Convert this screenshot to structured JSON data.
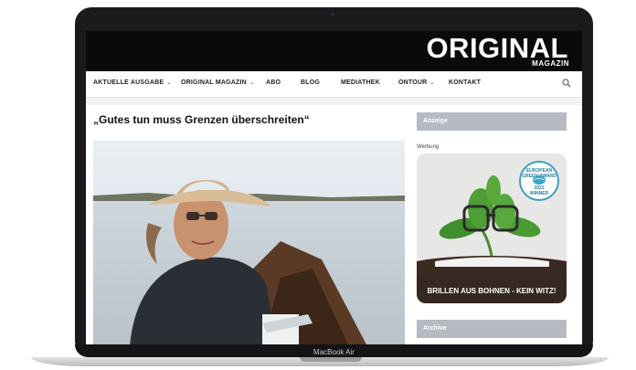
{
  "device": {
    "model_label": "MacBook Air"
  },
  "site": {
    "brand": {
      "logo": "ORIGINAL",
      "subtitle": "MAGAZIN"
    },
    "nav": [
      {
        "label": "AKTUELLE AUSGABE",
        "has_caret": true
      },
      {
        "label": "ORIGINAL MAGAZIN",
        "has_caret": true
      },
      {
        "label": "ABO",
        "has_caret": false
      },
      {
        "label": "BLOG",
        "has_caret": false
      },
      {
        "label": "MEDIATHEK",
        "has_caret": false
      },
      {
        "label": "ONTOUR",
        "has_caret": true
      },
      {
        "label": "KONTAKT",
        "has_caret": false
      }
    ],
    "article": {
      "title": "„Gutes tun muss Grenzen überschreiten“"
    },
    "sidebar": {
      "ad_header": "Anzeige",
      "ad_label": "Werbung",
      "ad_caption": "BRILLEN AUS BOHNEN - KEIN WITZ!",
      "badge": {
        "top": "EUROPEAN GREEN AWARD",
        "year": "2021",
        "bottom": "WINNER"
      },
      "archive_header": "Archive"
    }
  },
  "colors": {
    "header_bg": "#090a0c",
    "sidebar_header_bg": "#b6bbc3",
    "badge_accent": "#3c9fbe"
  }
}
